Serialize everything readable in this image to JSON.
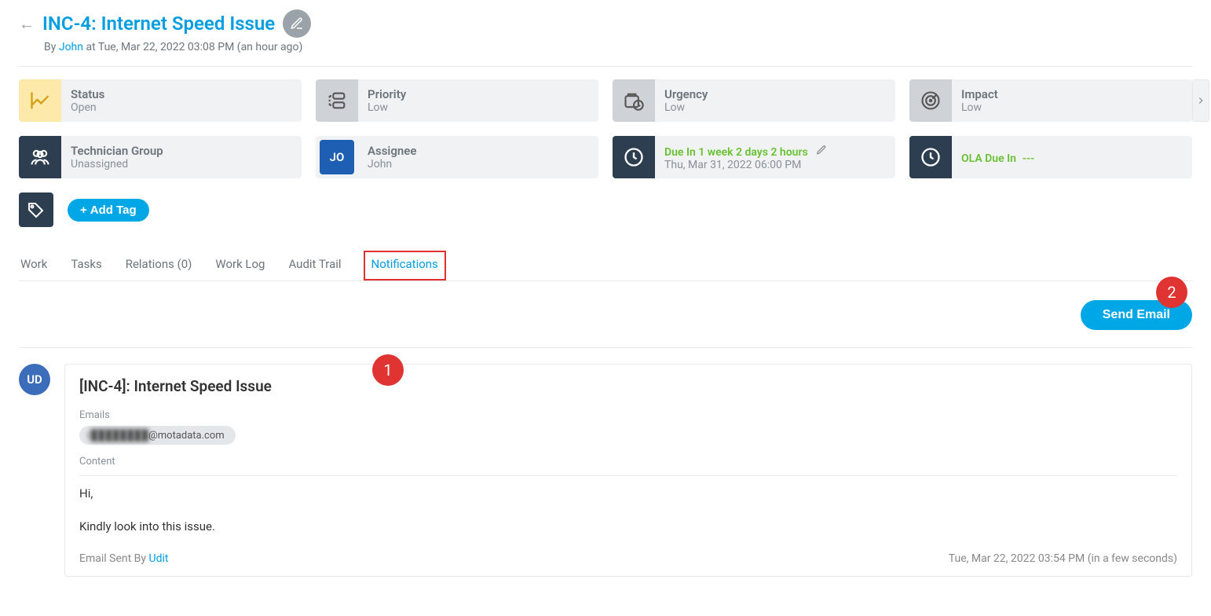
{
  "header": {
    "title": "INC-4: Internet Speed Issue",
    "by_prefix": "By",
    "author": "John",
    "at_text": "at Tue, Mar 22, 2022 03:08 PM (an hour ago)"
  },
  "cards": {
    "status": {
      "label": "Status",
      "value": "Open"
    },
    "priority": {
      "label": "Priority",
      "value": "Low"
    },
    "urgency": {
      "label": "Urgency",
      "value": "Low"
    },
    "impact": {
      "label": "Impact",
      "value": "Low"
    },
    "tech_group": {
      "label": "Technician Group",
      "value": "Unassigned"
    },
    "assignee": {
      "label": "Assignee",
      "value": "John",
      "initials": "JO"
    },
    "due": {
      "label": "Due In  1 week 2 days 2 hours",
      "value": "Thu, Mar 31, 2022 06:00 PM"
    },
    "ola": {
      "label": "OLA Due In",
      "value": "---"
    }
  },
  "tags": {
    "add_tag_label": "Add Tag"
  },
  "tabs": {
    "work": "Work",
    "tasks": "Tasks",
    "relations": "Relations (0)",
    "work_log": "Work Log",
    "audit_trail": "Audit Trail",
    "notifications": "Notifications"
  },
  "actions": {
    "send_email": "Send Email"
  },
  "badges": {
    "one": "1",
    "two": "2"
  },
  "notification": {
    "avatar": "UD",
    "title": "[INC-4]: Internet Speed Issue",
    "emails_label": "Emails",
    "email_blur": "r████████",
    "email_suffix": "@motadata.com",
    "content_label": "Content",
    "msg_line1": "Hi,",
    "msg_line2": "Kindly look into this issue.",
    "sent_by_label": "Email Sent By",
    "sent_by_name": "Udit",
    "timestamp": "Tue, Mar 22, 2022 03:54 PM (in a few seconds)"
  }
}
